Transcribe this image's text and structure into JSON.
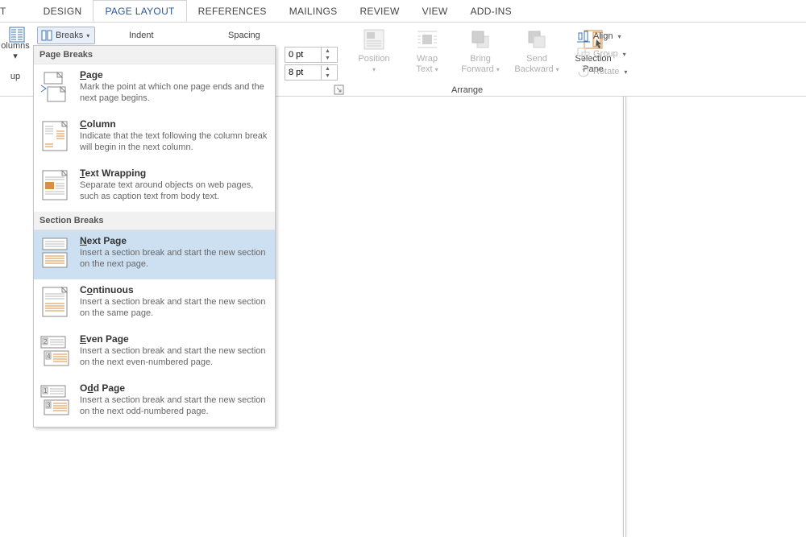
{
  "tabs": {
    "partial": "T",
    "design": "DESIGN",
    "page_layout": "PAGE LAYOUT",
    "references": "REFERENCES",
    "mailings": "MAILINGS",
    "review": "REVIEW",
    "view": "VIEW",
    "addins": "ADD-INS"
  },
  "ribbon": {
    "columns_label_1": "olumns",
    "columns_label_2": "up",
    "columns_caret": "▾",
    "breaks_label": "Breaks",
    "breaks_caret": "▾",
    "indent_label": "Indent",
    "spacing_label": "Spacing",
    "spacing_before": "0 pt",
    "spacing_after": "8 pt",
    "position": "Position",
    "wrap_text_1": "Wrap",
    "wrap_text_2": "Text",
    "bring_fwd_1": "Bring",
    "bring_fwd_2": "Forward",
    "send_back_1": "Send",
    "send_back_2": "Backward",
    "sel_pane_1": "Selection",
    "sel_pane_2": "Pane",
    "arrange_label": "Arrange",
    "align": "Align",
    "group": "Group",
    "rotate": "Rotate",
    "drop": "▾"
  },
  "menu": {
    "page_breaks_header": "Page Breaks",
    "section_breaks_header": "Section Breaks",
    "page": {
      "title_pre": "",
      "title_u": "P",
      "title_post": "age",
      "desc": "Mark the point at which one page ends and the next page begins."
    },
    "column": {
      "title_pre": "",
      "title_u": "C",
      "title_post": "olumn",
      "desc": "Indicate that the text following the column break will begin in the next column."
    },
    "text_wrapping": {
      "title_pre": "",
      "title_u": "T",
      "title_post": "ext Wrapping",
      "desc": "Separate text around objects on web pages, such as caption text from body text."
    },
    "next_page": {
      "title_pre": "",
      "title_u": "N",
      "title_post": "ext Page",
      "desc": "Insert a section break and start the new section on the next page."
    },
    "continuous": {
      "title_pre": "C",
      "title_u": "o",
      "title_post": "ntinuous",
      "desc": "Insert a section break and start the new section on the same page."
    },
    "even_page": {
      "title_pre": "",
      "title_u": "E",
      "title_post": "ven Page",
      "desc": "Insert a section break and start the new section on the next even-numbered page."
    },
    "odd_page": {
      "title_pre": "O",
      "title_u": "d",
      "title_post": "d Page",
      "desc": "Insert a section break and start the new section on the next odd-numbered page."
    }
  }
}
